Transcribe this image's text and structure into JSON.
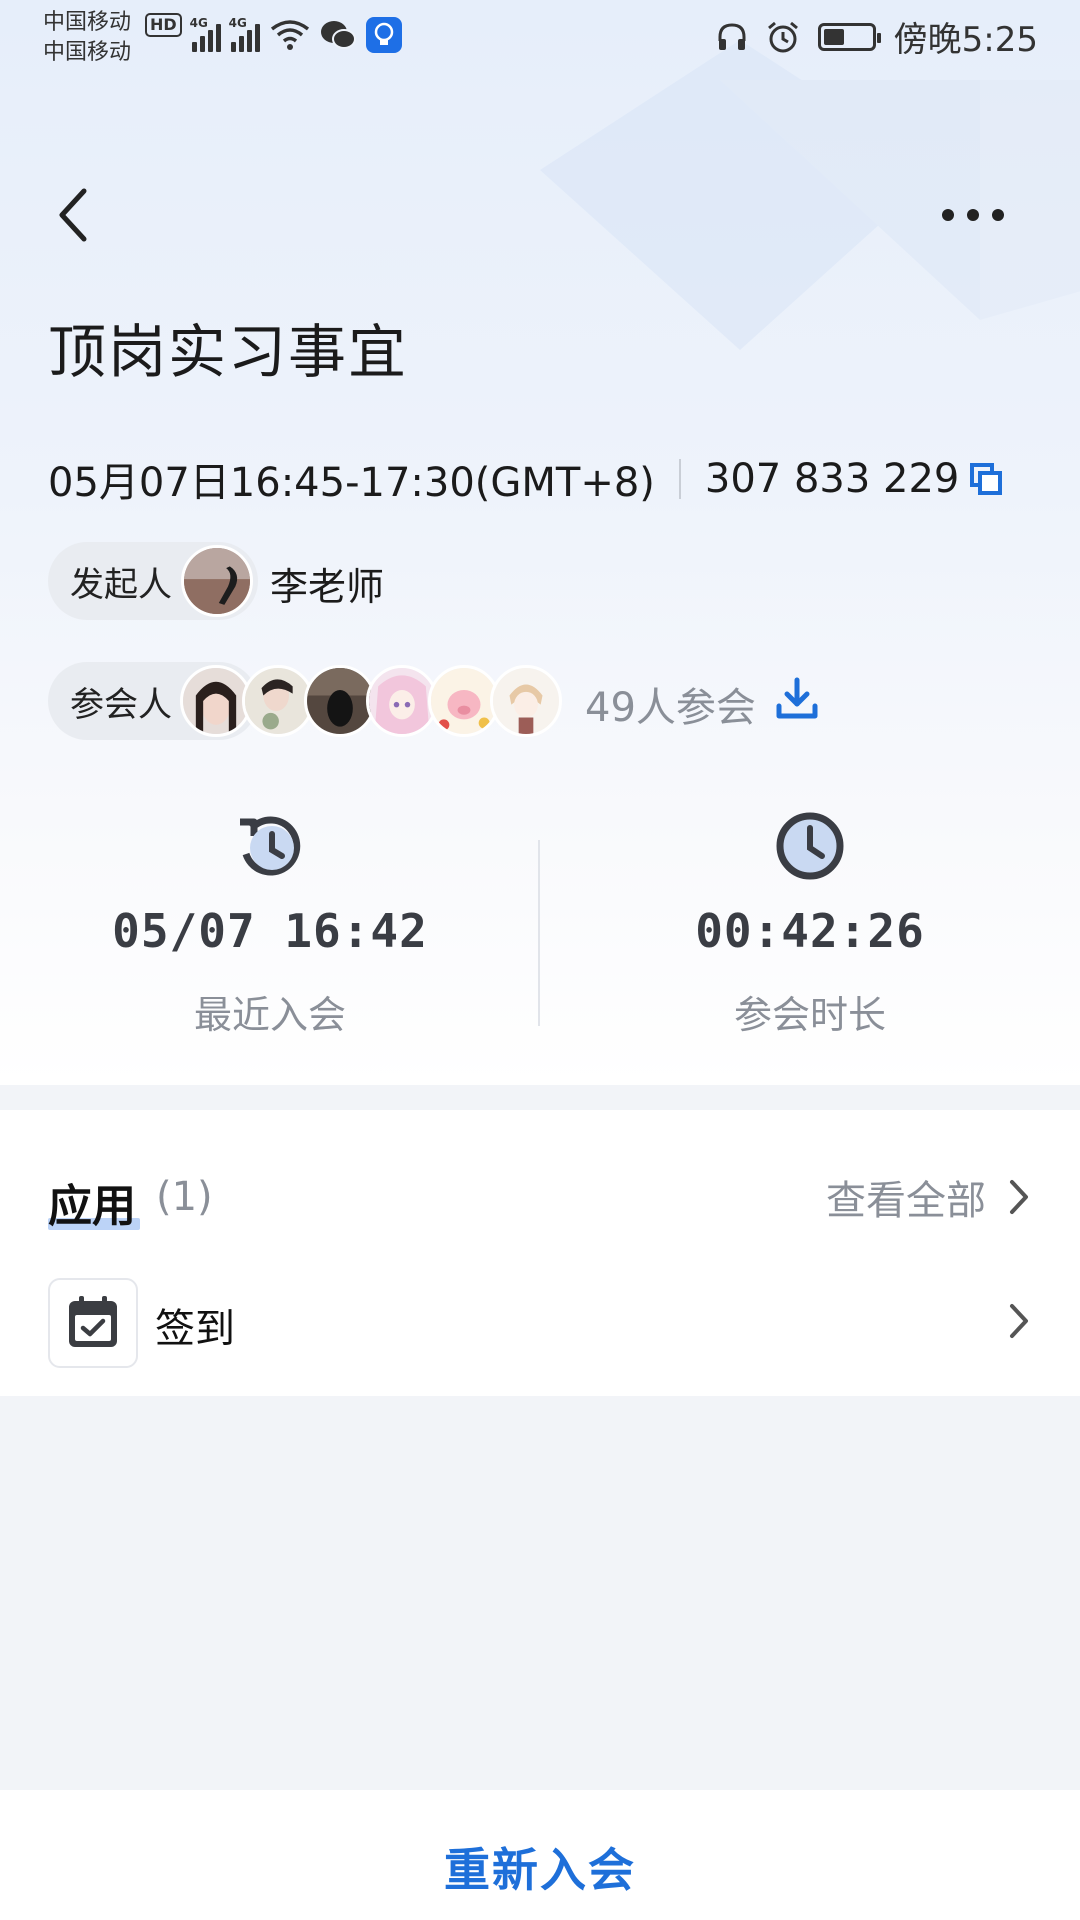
{
  "status_bar": {
    "carrier_1": "中国移动",
    "carrier_2": "中国移动",
    "hd": "HD",
    "network_1": "4G",
    "network_2": "4G",
    "time": "傍晚5:25"
  },
  "header": {
    "title": "顶岗实习事宜"
  },
  "meeting": {
    "time_range": "05月07日16:45-17:30(GMT+8)",
    "meeting_id": "307 833 229",
    "host_label": "发起人",
    "host_name": "李老师",
    "attendees_label": "参会人",
    "attendee_count": "49人参会"
  },
  "stats": {
    "last_join_value": "05/07 16:42",
    "last_join_label": "最近入会",
    "duration_value": "00:42:26",
    "duration_label": "参会时长"
  },
  "apps": {
    "title": "应用",
    "count": "(1)",
    "view_all": "查看全部",
    "items": [
      {
        "label": "签到",
        "icon": "calendar-check-icon"
      }
    ]
  },
  "footer": {
    "rejoin_label": "重新入会"
  },
  "colors": {
    "accent": "#1e6fd9",
    "secondary_text": "#8a8f98"
  }
}
